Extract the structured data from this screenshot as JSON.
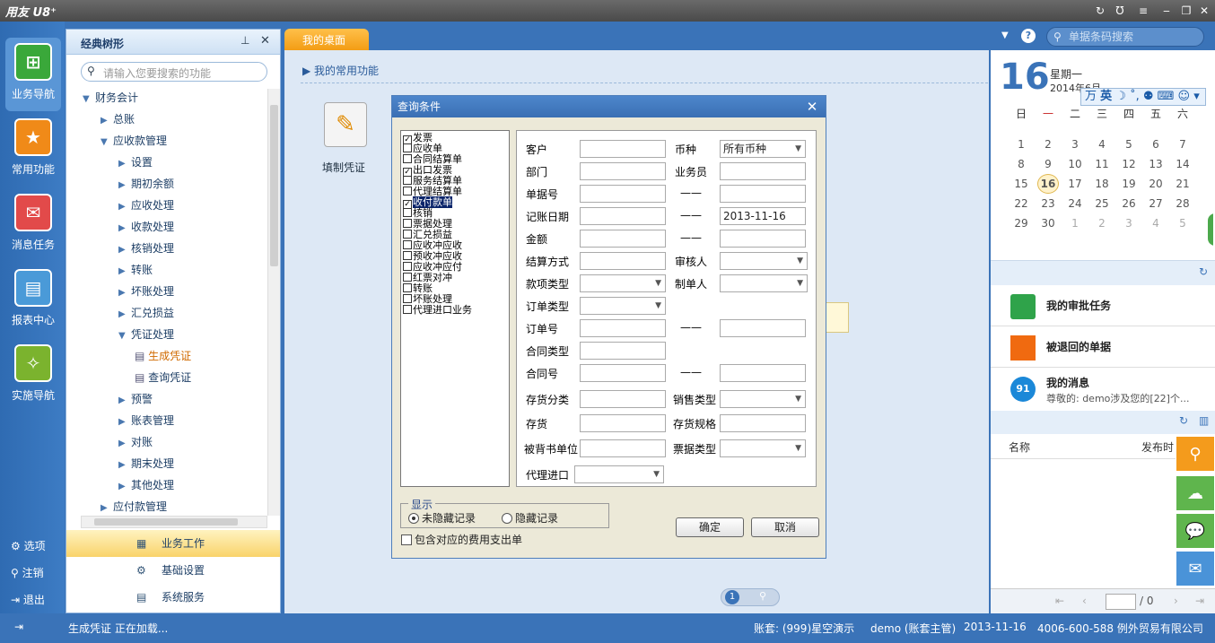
{
  "app": {
    "logo": "用友 U8⁺"
  },
  "rail": {
    "items": [
      "业务导航",
      "常用功能",
      "消息任务",
      "报表中心",
      "实施导航"
    ],
    "bottom": [
      "选项",
      "注销",
      "退出"
    ]
  },
  "tree": {
    "title": "经典树形",
    "search_placeholder": "请输入您要搜索的功能",
    "nodes": [
      "财务会计",
      "总账",
      "应收款管理",
      "设置",
      "期初余额",
      "应收处理",
      "收款处理",
      "核销处理",
      "转账",
      "坏账处理",
      "汇兑损益",
      "凭证处理",
      "生成凭证",
      "查询凭证",
      "预警",
      "账表管理",
      "对账",
      "期末处理",
      "其他处理",
      "应付款管理"
    ],
    "bottom": [
      "业务工作",
      "基础设置",
      "系统服务"
    ]
  },
  "tabs": {
    "desk": "我的桌面"
  },
  "search": {
    "placeholder": "单据条码搜索"
  },
  "main": {
    "section": "我的常用功能",
    "shortcut": "填制凭证"
  },
  "dialog": {
    "title": "查询条件",
    "types": [
      "发票",
      "应收单",
      "合同结算单",
      "出口发票",
      "服务结算单",
      "代理结算单",
      "收付款单",
      "核销",
      "票据处理",
      "汇兑损益",
      "应收冲应收",
      "预收冲应收",
      "应收冲应付",
      "红票对冲",
      "转账",
      "坏账处理",
      "代理进口业务"
    ],
    "labels": {
      "customer": "客户",
      "currency": "币种",
      "department": "部门",
      "salesperson": "业务员",
      "doc_no": "单据号",
      "post_date": "记账日期",
      "amount": "金额",
      "settle": "结算方式",
      "auditor": "审核人",
      "payment_type": "款项类型",
      "maker": "制单人",
      "order_type": "订单类型",
      "order_no": "订单号",
      "contract_type": "合同类型",
      "contract_no": "合同号",
      "inv_class": "存货分类",
      "sales_type": "销售类型",
      "inventory": "存货",
      "inv_spec": "存货规格",
      "endorser": "被背书单位",
      "bill_type": "票据类型",
      "agent_import": "代理进口"
    },
    "values": {
      "currency": "所有币种",
      "post_date_to": "2013-11-16"
    },
    "dash": "——",
    "display_legend": "显示",
    "radio_unhidden": "未隐藏记录",
    "radio_hidden": "隐藏记录",
    "include_fee": "包含对应的费用支出单",
    "ok": "确定",
    "cancel": "取消"
  },
  "right": {
    "day": "16",
    "weekday": "星期一",
    "yearmonth": "2014年6月",
    "ime": "英",
    "week_headers": [
      "日",
      "一",
      "二",
      "三",
      "四",
      "五",
      "六"
    ],
    "weeks": [
      [
        "1",
        "2",
        "3",
        "4",
        "5",
        "6",
        "7"
      ],
      [
        "8",
        "9",
        "10",
        "11",
        "12",
        "13",
        "14"
      ],
      [
        "15",
        "16",
        "17",
        "18",
        "19",
        "20",
        "21"
      ],
      [
        "22",
        "23",
        "24",
        "25",
        "26",
        "27",
        "28"
      ],
      [
        "29",
        "30",
        "1",
        "2",
        "3",
        "4",
        "5"
      ]
    ],
    "tasks": [
      "我的审批任务",
      "被退回的单据",
      "我的消息"
    ],
    "msg_count": "91",
    "msg_preview": "尊敬的: demo涉及您的[22]个...",
    "col_name": "名称",
    "col_time": "发布时",
    "page": "/ 0"
  },
  "pager": {
    "current": "1"
  },
  "status": {
    "left": "生成凭证  正在加载...",
    "account": "账套: (999)星空演示",
    "user": "demo (账套主管)",
    "date": "2013-11-16",
    "company": "4006-600-588 例外贸易有限公司"
  }
}
